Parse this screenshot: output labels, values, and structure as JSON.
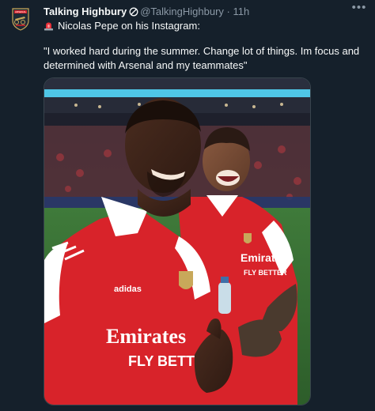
{
  "author": {
    "display_name": "Talking Highbury",
    "handle": "@TalkingHighbury",
    "separator": "·",
    "time": "11h"
  },
  "icons": {
    "avatar": "cannon-crest-avatar",
    "verified": "circle-slash-badge-icon",
    "more": "more-options-icon",
    "siren": "siren-emoji-icon"
  },
  "tweet": {
    "intro": "Nicolas Pepe on his Instagram:",
    "quote": "\"I worked hard during the summer. Change lot of things. Im focus and determined with Arsenal and my teammates\""
  },
  "media": {
    "description_kind": "photo",
    "shirt_text_front": "Emirates",
    "shirt_text_sub": "FLY BETTER",
    "shirt_text_back_player": "Emirates",
    "shirt_text_back_sub": "FLY BETTER",
    "brand": "adidas"
  },
  "colors": {
    "background": "#15202b",
    "text": "#f7f9f9",
    "muted": "#8b98a5",
    "arsenal_red": "#d8232a",
    "white": "#ffffff"
  }
}
